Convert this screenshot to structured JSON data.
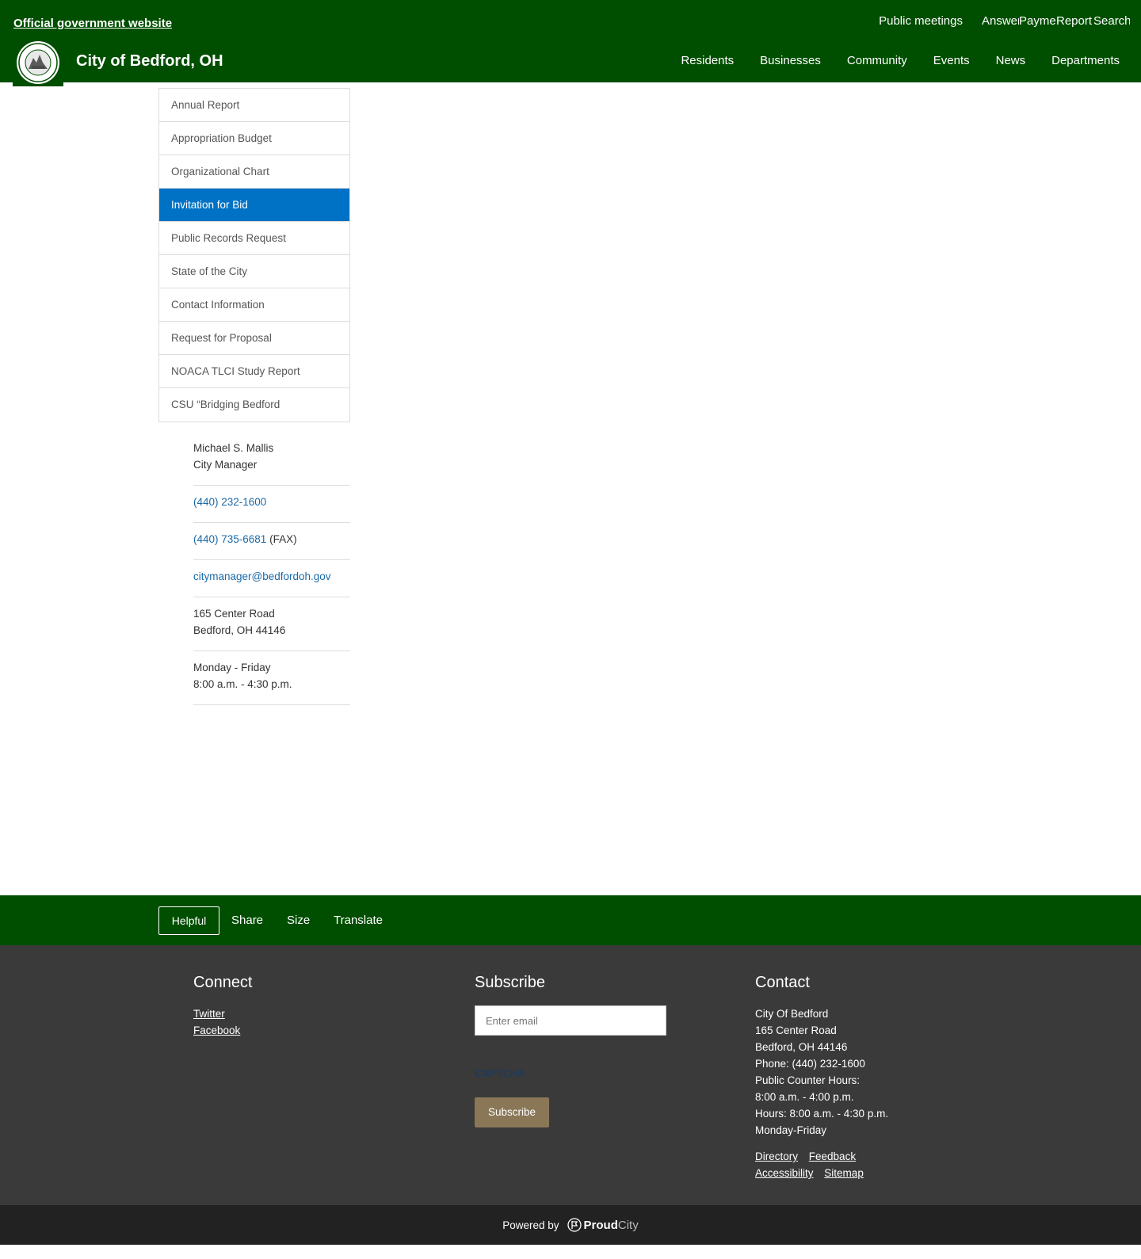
{
  "header": {
    "gov_banner": "Official government website",
    "site_title": "City of Bedford, OH",
    "utility": {
      "public_meetings": "Public meetings",
      "answers": "Answers",
      "payments": "Payments",
      "report": "Report",
      "search": "Search"
    },
    "nav": [
      "Residents",
      "Businesses",
      "Community",
      "Events",
      "News",
      "Departments"
    ]
  },
  "sidebar": {
    "items": [
      {
        "label": "Annual Report"
      },
      {
        "label": "Appropriation Budget"
      },
      {
        "label": "Organizational Chart"
      },
      {
        "label": "Invitation for Bid"
      },
      {
        "label": "Public Records Request"
      },
      {
        "label": "State of the City"
      },
      {
        "label": "Contact Information"
      },
      {
        "label": "Request for Proposal"
      },
      {
        "label": "NOACA TLCI Study Report"
      },
      {
        "label": "CSU “Bridging Bedford"
      }
    ],
    "active_index": 3
  },
  "contact": {
    "name": "Michael S. Mallis",
    "title": "City Manager",
    "phone": "(440) 232-1600",
    "fax": "(440) 735-6681",
    "fax_suffix": " (FAX)",
    "email": "citymanager@bedfordoh.gov",
    "address_line1": "165 Center Road",
    "address_line2": "Bedford, OH 44146",
    "hours_days": "Monday - Friday",
    "hours_time": "8:00 a.m. - 4:30 p.m."
  },
  "actionbar": {
    "helpful": "Helpful",
    "share": "Share",
    "size": "Size",
    "translate": "Translate"
  },
  "footer": {
    "connect": {
      "heading": "Connect",
      "twitter": "Twitter",
      "facebook": "Facebook"
    },
    "subscribe": {
      "heading": "Subscribe",
      "placeholder": "Enter email",
      "captcha": "CAPTCHA",
      "button": "Subscribe"
    },
    "contact": {
      "heading": "Contact",
      "lines": [
        "City Of Bedford",
        "165 Center Road",
        "Bedford, OH 44146",
        "Phone: (440) 232-1600",
        "Public Counter Hours:",
        "8:00 a.m. - 4:00 p.m.",
        "Hours: 8:00 a.m. - 4:30 p.m.",
        "Monday-Friday"
      ],
      "links": [
        "Directory",
        "Feedback",
        "Accessibility",
        "Sitemap"
      ]
    }
  },
  "powered": {
    "prefix": "Powered by",
    "brand_bold": "Proud",
    "brand_light": "City"
  },
  "colors": {
    "header_green": "#004e00",
    "active_blue": "#0072c6",
    "footer_gray": "#3a3a3a",
    "subscribe_tan": "#8a7758"
  }
}
